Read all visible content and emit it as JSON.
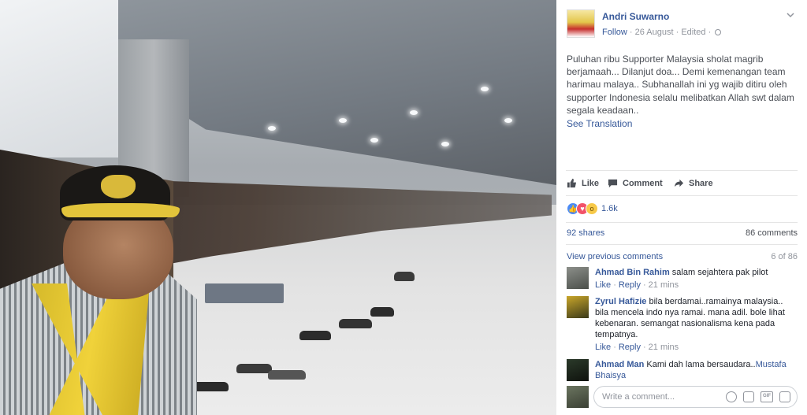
{
  "post": {
    "author": "Andri Suwarno",
    "follow": "Follow",
    "date": "26 August",
    "edited": "Edited",
    "text": "Puluhan ribu Supporter Malaysia sholat magrib berjamaah... Dilanjut doa... Demi kemenangan team harimau malaya.. Subhanallah ini yg wajib ditiru oleh supporter Indonesia selalu melibatkan Allah swt dalam segala keadaan..",
    "see_translation": "See Translation"
  },
  "actions": {
    "like": "Like",
    "comment": "Comment",
    "share": "Share"
  },
  "reactions": {
    "count": "1.6k"
  },
  "stats": {
    "shares": "92 shares",
    "comments": "86 comments"
  },
  "comments_header": {
    "view_previous": "View previous comments",
    "count": "6 of 86"
  },
  "comments": [
    {
      "name": "Ahmad Bin Rahim",
      "text": "salam sejahtera pak pilot",
      "like": "Like",
      "reply": "Reply",
      "time": "21 mins"
    },
    {
      "name": "Zyrul Hafizie",
      "text": "bila berdamai..ramainya malaysia.. bila mencela indo nya ramai. mana adil. bole lihat kebenaran. semangat nasionalisma kena pada tempatnya.",
      "like": "Like",
      "reply": "Reply",
      "time": "21 mins"
    },
    {
      "name": "Ahmad Man",
      "text": "Kami dah lama bersaudara..",
      "mention": "Mustafa Bhaisya"
    }
  ],
  "write_comment": {
    "placeholder": "Write a comment..."
  },
  "colors": {
    "link": "#365899",
    "muted": "#90949c",
    "text": "#4b4f56"
  }
}
